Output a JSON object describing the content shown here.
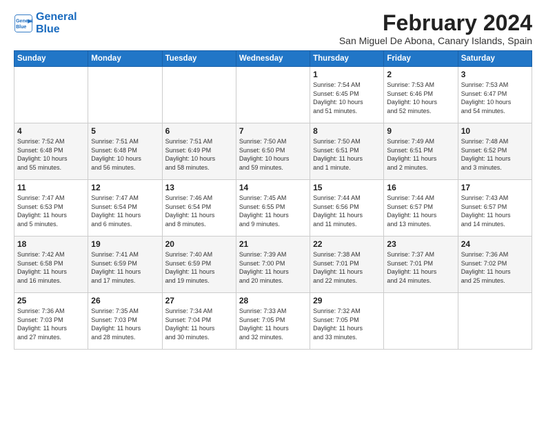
{
  "header": {
    "logo_text_general": "General",
    "logo_text_blue": "Blue",
    "month_title": "February 2024",
    "subtitle": "San Miguel De Abona, Canary Islands, Spain"
  },
  "weekdays": [
    "Sunday",
    "Monday",
    "Tuesday",
    "Wednesday",
    "Thursday",
    "Friday",
    "Saturday"
  ],
  "weeks": [
    [
      {
        "day": "",
        "info": ""
      },
      {
        "day": "",
        "info": ""
      },
      {
        "day": "",
        "info": ""
      },
      {
        "day": "",
        "info": ""
      },
      {
        "day": "1",
        "info": "Sunrise: 7:54 AM\nSunset: 6:45 PM\nDaylight: 10 hours\nand 51 minutes."
      },
      {
        "day": "2",
        "info": "Sunrise: 7:53 AM\nSunset: 6:46 PM\nDaylight: 10 hours\nand 52 minutes."
      },
      {
        "day": "3",
        "info": "Sunrise: 7:53 AM\nSunset: 6:47 PM\nDaylight: 10 hours\nand 54 minutes."
      }
    ],
    [
      {
        "day": "4",
        "info": "Sunrise: 7:52 AM\nSunset: 6:48 PM\nDaylight: 10 hours\nand 55 minutes."
      },
      {
        "day": "5",
        "info": "Sunrise: 7:51 AM\nSunset: 6:48 PM\nDaylight: 10 hours\nand 56 minutes."
      },
      {
        "day": "6",
        "info": "Sunrise: 7:51 AM\nSunset: 6:49 PM\nDaylight: 10 hours\nand 58 minutes."
      },
      {
        "day": "7",
        "info": "Sunrise: 7:50 AM\nSunset: 6:50 PM\nDaylight: 10 hours\nand 59 minutes."
      },
      {
        "day": "8",
        "info": "Sunrise: 7:50 AM\nSunset: 6:51 PM\nDaylight: 11 hours\nand 1 minute."
      },
      {
        "day": "9",
        "info": "Sunrise: 7:49 AM\nSunset: 6:51 PM\nDaylight: 11 hours\nand 2 minutes."
      },
      {
        "day": "10",
        "info": "Sunrise: 7:48 AM\nSunset: 6:52 PM\nDaylight: 11 hours\nand 3 minutes."
      }
    ],
    [
      {
        "day": "11",
        "info": "Sunrise: 7:47 AM\nSunset: 6:53 PM\nDaylight: 11 hours\nand 5 minutes."
      },
      {
        "day": "12",
        "info": "Sunrise: 7:47 AM\nSunset: 6:54 PM\nDaylight: 11 hours\nand 6 minutes."
      },
      {
        "day": "13",
        "info": "Sunrise: 7:46 AM\nSunset: 6:54 PM\nDaylight: 11 hours\nand 8 minutes."
      },
      {
        "day": "14",
        "info": "Sunrise: 7:45 AM\nSunset: 6:55 PM\nDaylight: 11 hours\nand 9 minutes."
      },
      {
        "day": "15",
        "info": "Sunrise: 7:44 AM\nSunset: 6:56 PM\nDaylight: 11 hours\nand 11 minutes."
      },
      {
        "day": "16",
        "info": "Sunrise: 7:44 AM\nSunset: 6:57 PM\nDaylight: 11 hours\nand 13 minutes."
      },
      {
        "day": "17",
        "info": "Sunrise: 7:43 AM\nSunset: 6:57 PM\nDaylight: 11 hours\nand 14 minutes."
      }
    ],
    [
      {
        "day": "18",
        "info": "Sunrise: 7:42 AM\nSunset: 6:58 PM\nDaylight: 11 hours\nand 16 minutes."
      },
      {
        "day": "19",
        "info": "Sunrise: 7:41 AM\nSunset: 6:59 PM\nDaylight: 11 hours\nand 17 minutes."
      },
      {
        "day": "20",
        "info": "Sunrise: 7:40 AM\nSunset: 6:59 PM\nDaylight: 11 hours\nand 19 minutes."
      },
      {
        "day": "21",
        "info": "Sunrise: 7:39 AM\nSunset: 7:00 PM\nDaylight: 11 hours\nand 20 minutes."
      },
      {
        "day": "22",
        "info": "Sunrise: 7:38 AM\nSunset: 7:01 PM\nDaylight: 11 hours\nand 22 minutes."
      },
      {
        "day": "23",
        "info": "Sunrise: 7:37 AM\nSunset: 7:01 PM\nDaylight: 11 hours\nand 24 minutes."
      },
      {
        "day": "24",
        "info": "Sunrise: 7:36 AM\nSunset: 7:02 PM\nDaylight: 11 hours\nand 25 minutes."
      }
    ],
    [
      {
        "day": "25",
        "info": "Sunrise: 7:36 AM\nSunset: 7:03 PM\nDaylight: 11 hours\nand 27 minutes."
      },
      {
        "day": "26",
        "info": "Sunrise: 7:35 AM\nSunset: 7:03 PM\nDaylight: 11 hours\nand 28 minutes."
      },
      {
        "day": "27",
        "info": "Sunrise: 7:34 AM\nSunset: 7:04 PM\nDaylight: 11 hours\nand 30 minutes."
      },
      {
        "day": "28",
        "info": "Sunrise: 7:33 AM\nSunset: 7:05 PM\nDaylight: 11 hours\nand 32 minutes."
      },
      {
        "day": "29",
        "info": "Sunrise: 7:32 AM\nSunset: 7:05 PM\nDaylight: 11 hours\nand 33 minutes."
      },
      {
        "day": "",
        "info": ""
      },
      {
        "day": "",
        "info": ""
      }
    ]
  ]
}
